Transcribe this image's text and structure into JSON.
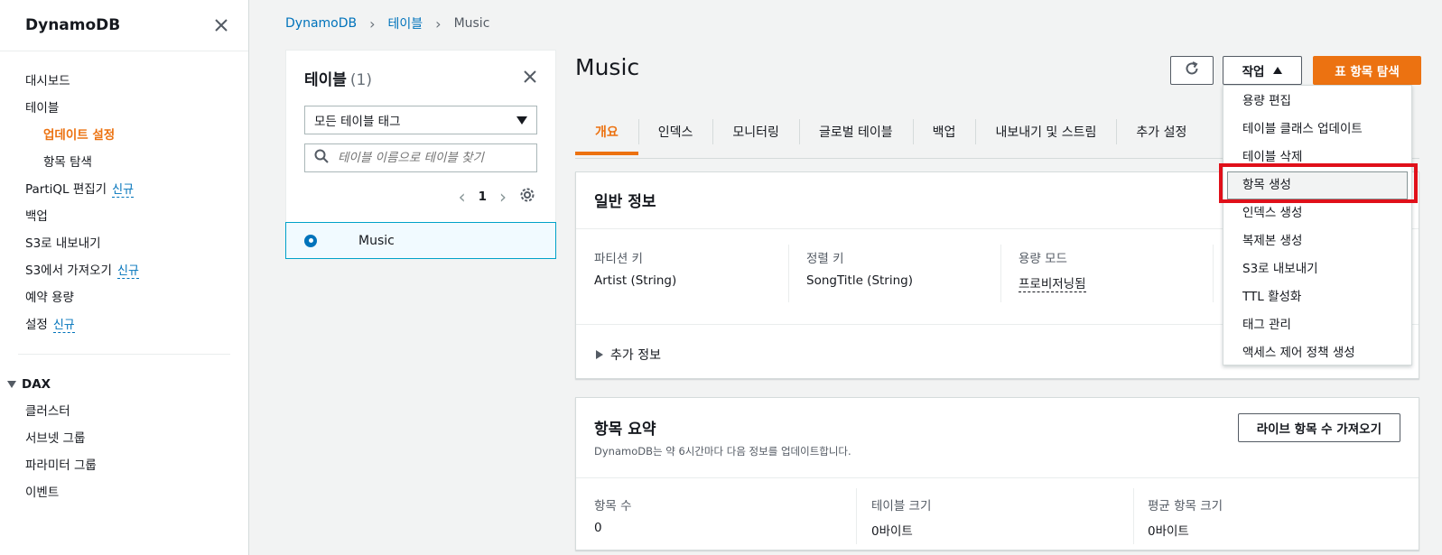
{
  "sidebar": {
    "title": "DynamoDB",
    "items": [
      {
        "label": "대시보드"
      },
      {
        "label": "테이블"
      },
      {
        "label": "업데이트 설정"
      },
      {
        "label": "항목 탐색"
      },
      {
        "label": "PartiQL 편집기",
        "badge": "신규"
      },
      {
        "label": "백업"
      },
      {
        "label": "S3로 내보내기"
      },
      {
        "label": "S3에서 가져오기",
        "badge": "신규"
      },
      {
        "label": "예약 용량"
      },
      {
        "label": "설정",
        "badge": "신규"
      }
    ],
    "dax_section": "DAX",
    "dax_items": [
      {
        "label": "클러스터"
      },
      {
        "label": "서브넷 그룹"
      },
      {
        "label": "파라미터 그룹"
      },
      {
        "label": "이벤트"
      }
    ]
  },
  "breadcrumb": [
    "DynamoDB",
    "테이블",
    "Music"
  ],
  "table_panel": {
    "title": "테이블",
    "count": "(1)",
    "tag_filter": "모든 테이블 태그",
    "search_placeholder": "테이블 이름으로 테이블 찾기",
    "page": "1",
    "rows": [
      {
        "name": "Music"
      }
    ]
  },
  "main": {
    "title": "Music",
    "actions_label": "작업",
    "explore_label": "표 항목 탐색",
    "tabs": [
      "개요",
      "인덱스",
      "모니터링",
      "글로벌 테이블",
      "백업",
      "내보내기 및 스트림",
      "추가 설정"
    ],
    "general": {
      "title": "일반 정보",
      "fields": [
        {
          "label": "파티션 키",
          "value": "Artist (String)"
        },
        {
          "label": "정렬 키",
          "value": "SongTitle (String)"
        },
        {
          "label": "용량 모드",
          "value": "프로비저닝됨"
        }
      ],
      "more": "추가 정보"
    },
    "summary": {
      "title": "항목 요약",
      "desc": "DynamoDB는 약 6시간마다 다음 정보를 업데이트합니다.",
      "live_button": "라이브 항목 수 가져오기",
      "fields": [
        {
          "label": "항목 수",
          "value": "0"
        },
        {
          "label": "테이블 크기",
          "value": "0바이트"
        },
        {
          "label": "평균 항목 크기",
          "value": "0바이트"
        }
      ]
    }
  },
  "actions_menu": [
    "용량 편집",
    "테이블 클래스 업데이트",
    "테이블 삭제",
    "항목 생성",
    "인덱스 생성",
    "복제본 생성",
    "S3로 내보내기",
    "TTL 활성화",
    "태그 관리",
    "액세스 제어 정책 생성"
  ],
  "colors": {
    "accent": "#ec7211",
    "link": "#0073bb",
    "highlight": "#e0101a"
  }
}
